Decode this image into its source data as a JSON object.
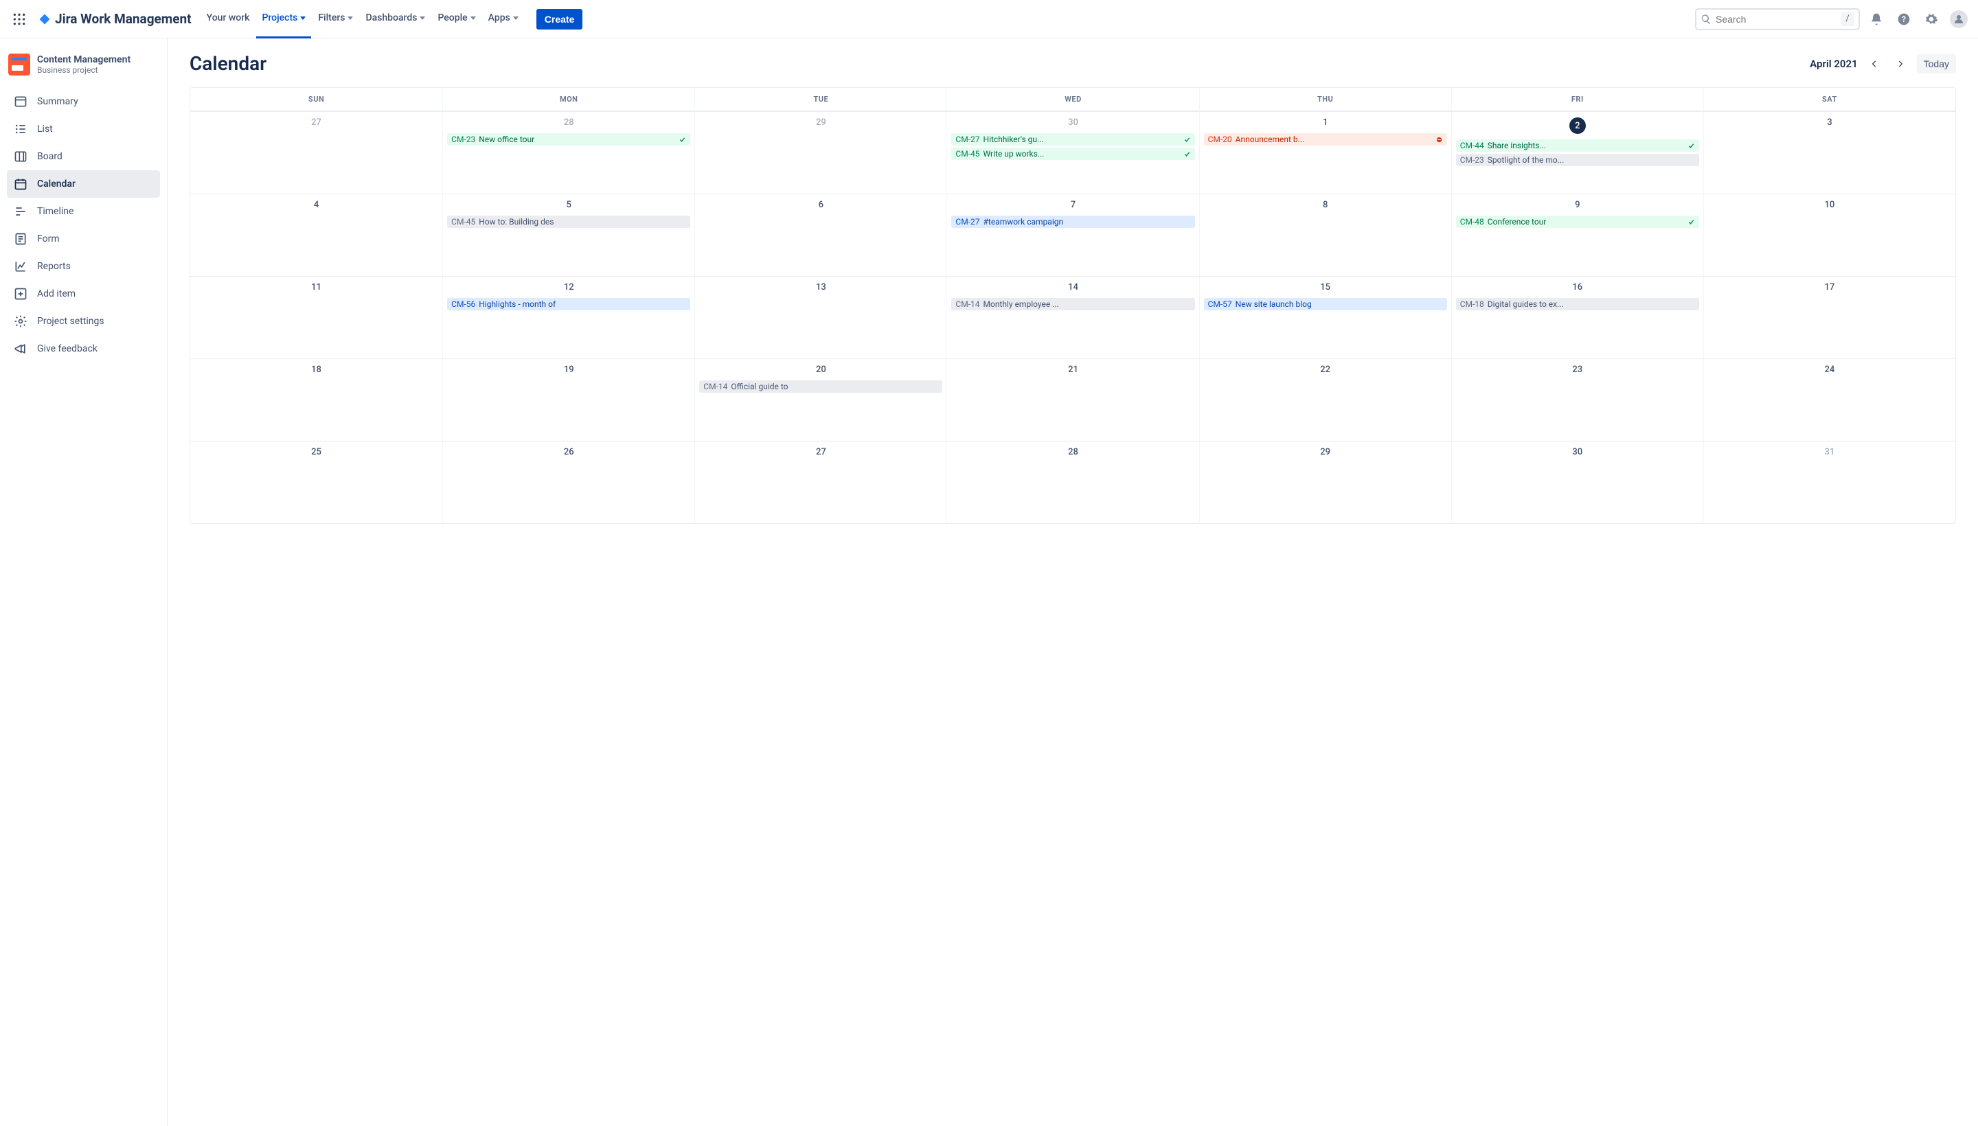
{
  "product_name": "Jira Work Management",
  "nav": {
    "your_work": "Your work",
    "projects": "Projects",
    "filters": "Filters",
    "dashboards": "Dashboards",
    "people": "People",
    "apps": "Apps",
    "create": "Create"
  },
  "search": {
    "placeholder": "Search",
    "shortcut": "/"
  },
  "project": {
    "name": "Content Management",
    "type": "Business project"
  },
  "sidebar": {
    "summary": "Summary",
    "list": "List",
    "board": "Board",
    "calendar": "Calendar",
    "timeline": "Timeline",
    "form": "Form",
    "reports": "Reports",
    "add_item": "Add item",
    "project_settings": "Project settings",
    "give_feedback": "Give feedback"
  },
  "calendar": {
    "title": "Calendar",
    "month": "April 2021",
    "today_label": "Today",
    "weekdays": [
      "SUN",
      "MON",
      "TUE",
      "WED",
      "THU",
      "FRI",
      "SAT"
    ],
    "days": {
      "w1": [
        "27",
        "28",
        "29",
        "30",
        "1",
        "2",
        "3"
      ],
      "w2": [
        "4",
        "5",
        "6",
        "7",
        "8",
        "9",
        "10"
      ],
      "w3": [
        "11",
        "12",
        "13",
        "14",
        "15",
        "16",
        "17"
      ],
      "w4": [
        "18",
        "19",
        "20",
        "21",
        "22",
        "23",
        "24"
      ],
      "w5": [
        "25",
        "26",
        "27",
        "28",
        "29",
        "30",
        "31"
      ]
    }
  },
  "events": {
    "w1_mon_0": {
      "key": "CM-23",
      "text": "New office tour"
    },
    "w1_wed_0": {
      "key": "CM-27",
      "text": "Hitchhiker's gu..."
    },
    "w1_wed_1": {
      "key": "CM-45",
      "text": "Write up works..."
    },
    "w1_thu_0": {
      "key": "CM-20",
      "text": "Announcement b..."
    },
    "w1_fri_0": {
      "key": "CM-44",
      "text": "Share insights..."
    },
    "w1_fri_1": {
      "key": "CM-23",
      "text": "Spotlight of the mo..."
    },
    "w2_mon_0": {
      "key": "CM-45",
      "text": "How to: Building des"
    },
    "w2_wed_0": {
      "key": "CM-27",
      "text": "#teamwork campaign"
    },
    "w2_fri_0": {
      "key": "CM-48",
      "text": "Conference tour"
    },
    "w3_mon_0": {
      "key": "CM-56",
      "text": "Highlights - month of"
    },
    "w3_wed_0": {
      "key": "CM-14",
      "text": "Monthly employee ..."
    },
    "w3_thu_0": {
      "key": "CM-57",
      "text": "New site launch blog"
    },
    "w3_fri_0": {
      "key": "CM-18",
      "text": "Digital guides to ex..."
    },
    "w4_tue_0": {
      "key": "CM-14",
      "text": "Official guide to"
    }
  }
}
